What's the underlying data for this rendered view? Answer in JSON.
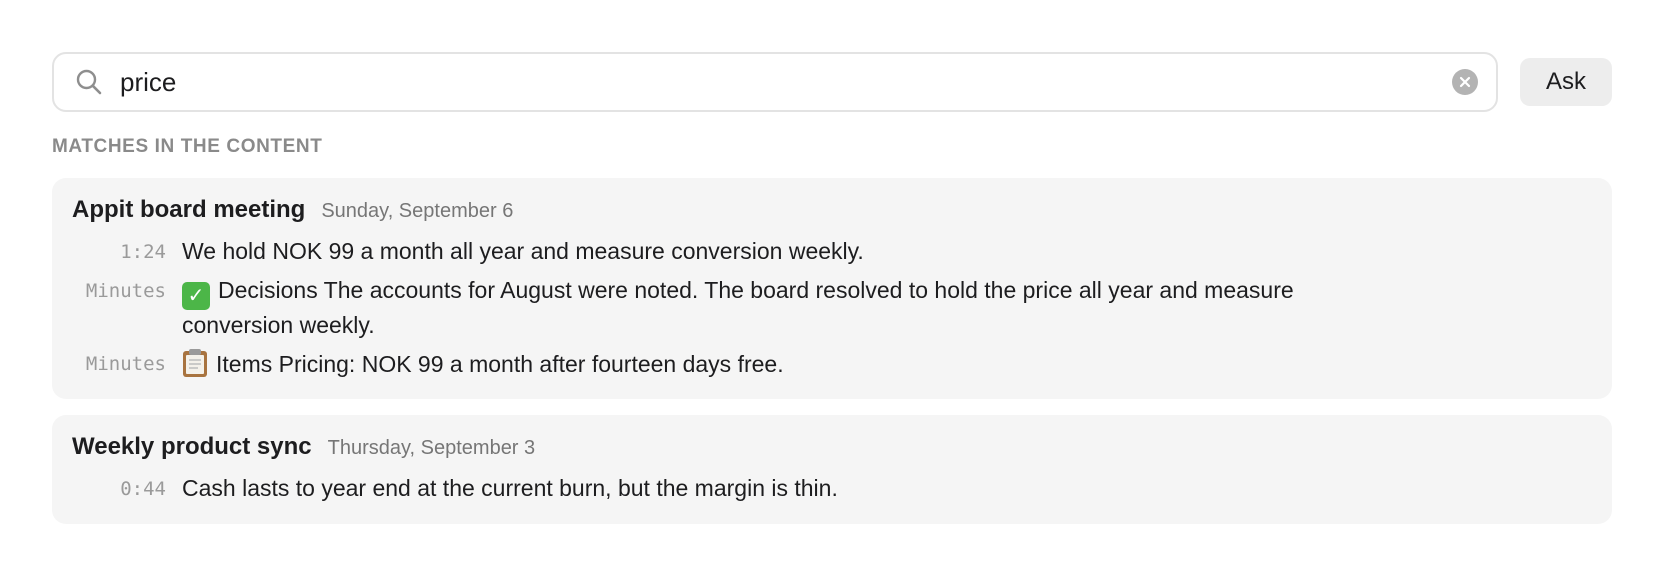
{
  "search": {
    "value": "price",
    "ask_label": "Ask"
  },
  "section_label": "MATCHES IN THE CONTENT",
  "results": [
    {
      "title": "Appit board meeting",
      "date": "Sunday, September 6",
      "matches": [
        {
          "source": "1:24",
          "text": "We hold NOK 99 a month all year and measure conversion weekly."
        },
        {
          "source": "Minutes",
          "icon": "check-mark-icon",
          "text": "Decisions The accounts for August were noted. The board resolved to hold the price all year and measure conversion weekly."
        },
        {
          "source": "Minutes",
          "icon": "clipboard-icon",
          "text": "Items Pricing: NOK 99 a month after fourteen days free."
        }
      ]
    },
    {
      "title": "Weekly product sync",
      "date": "Thursday, September 3",
      "matches": [
        {
          "source": "0:44",
          "text": "Cash lasts to year end at the current burn, but the margin is thin."
        }
      ]
    }
  ],
  "colors": {
    "card_background": "#f5f5f5",
    "check_green": "#4cb648",
    "muted_text": "#8a8a8a"
  }
}
